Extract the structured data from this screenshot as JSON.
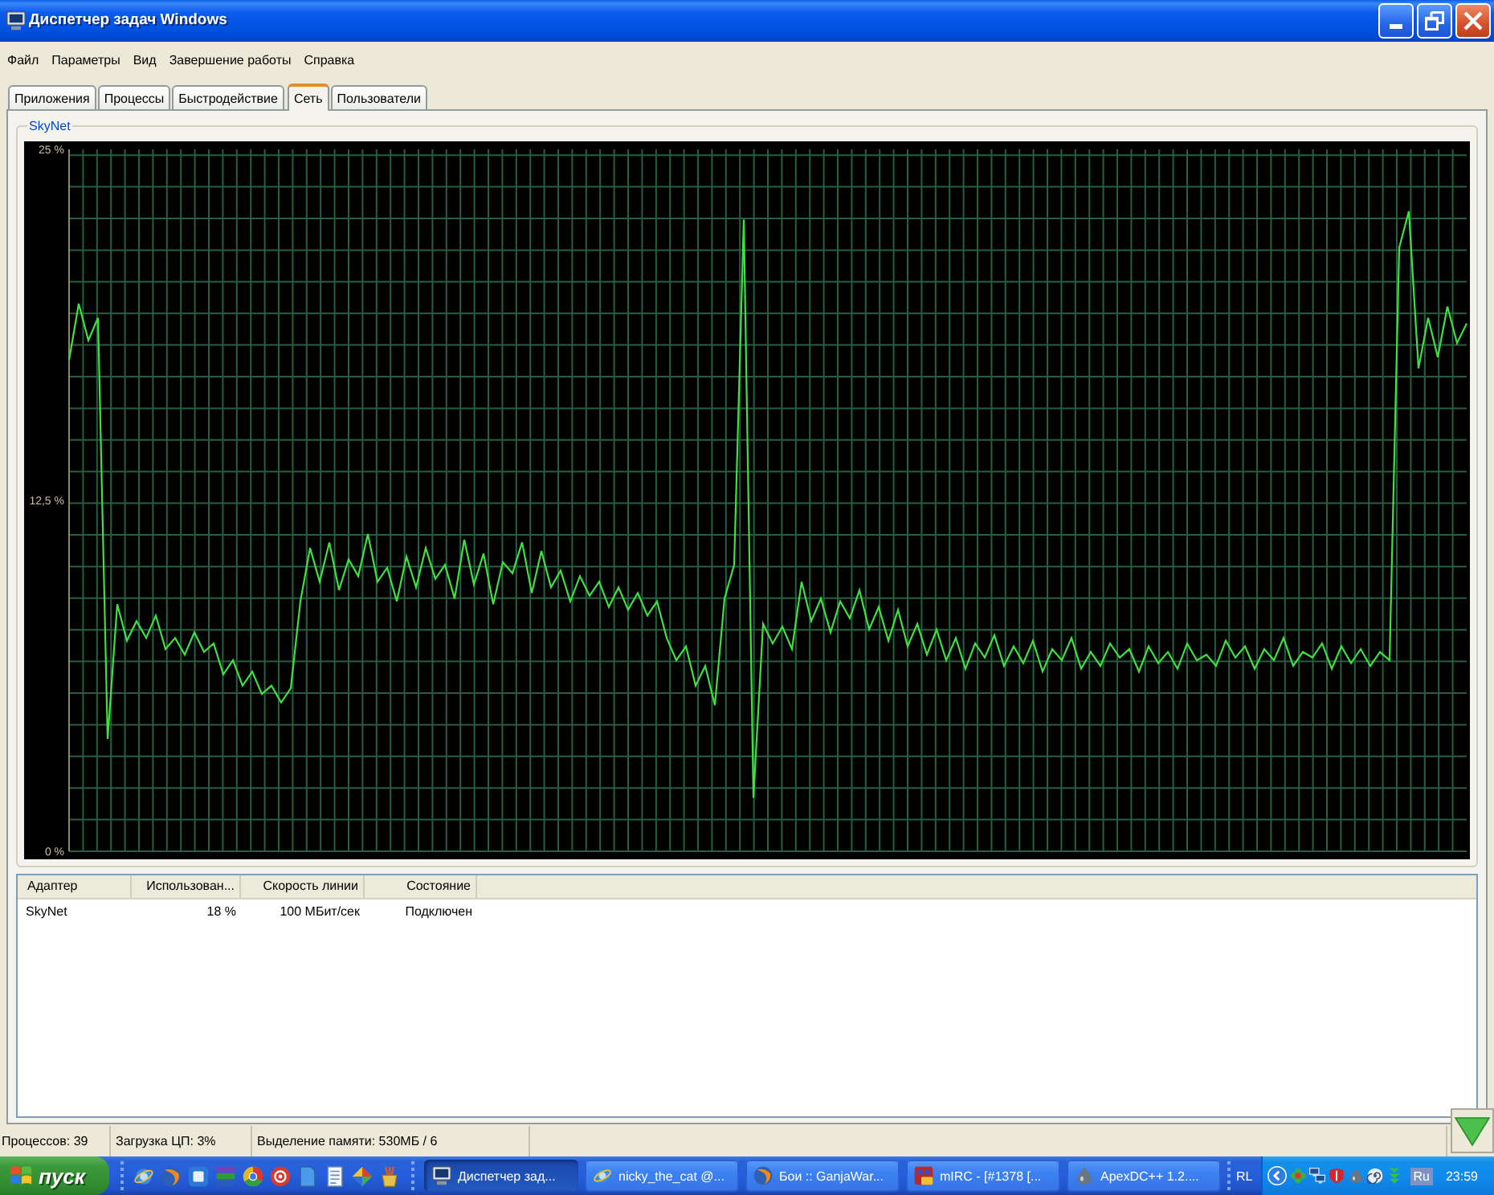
{
  "window": {
    "title": "Диспетчер задач Windows"
  },
  "menu": [
    "Файл",
    "Параметры",
    "Вид",
    "Завершение работы",
    "Справка"
  ],
  "tabs": [
    {
      "label": "Приложения",
      "selected": false
    },
    {
      "label": "Процессы",
      "selected": false
    },
    {
      "label": "Быстродействие",
      "selected": false
    },
    {
      "label": "Сеть",
      "selected": true
    },
    {
      "label": "Пользователи",
      "selected": false
    }
  ],
  "network_graph": {
    "title": "SkyNet",
    "chart_data": {
      "type": "line",
      "ylim": [
        0,
        25
      ],
      "yticks": [
        {
          "value": 0,
          "label": "0 %"
        },
        {
          "value": 12.5,
          "label": "12,5 %"
        },
        {
          "value": 25,
          "label": "25 %"
        }
      ],
      "values": [
        17.5,
        19.5,
        18.2,
        19.0,
        4.0,
        8.8,
        7.5,
        8.2,
        7.6,
        8.4,
        7.2,
        7.6,
        7.0,
        7.8,
        7.1,
        7.4,
        6.3,
        6.8,
        5.9,
        6.4,
        5.6,
        5.9,
        5.3,
        5.8,
        8.9,
        10.8,
        9.6,
        11.0,
        9.3,
        10.4,
        9.8,
        11.3,
        9.6,
        10.1,
        8.9,
        10.5,
        9.4,
        10.8,
        9.7,
        10.2,
        9.0,
        11.1,
        9.5,
        10.6,
        8.8,
        10.3,
        9.9,
        11.0,
        9.2,
        10.7,
        9.4,
        10.0,
        8.9,
        9.8,
        9.1,
        9.6,
        8.7,
        9.4,
        8.6,
        9.2,
        8.4,
        8.9,
        7.6,
        6.8,
        7.3,
        5.9,
        6.6,
        5.2,
        9.0,
        10.2,
        22.5,
        1.9,
        8.1,
        7.4,
        8.0,
        7.2,
        9.6,
        8.2,
        9.0,
        7.8,
        8.9,
        8.3,
        9.3,
        7.9,
        8.7,
        7.5,
        8.6,
        7.3,
        8.1,
        7.0,
        7.9,
        6.8,
        7.6,
        6.5,
        7.4,
        6.9,
        7.7,
        6.6,
        7.3,
        6.7,
        7.5,
        6.4,
        7.2,
        6.8,
        7.6,
        6.5,
        7.1,
        6.6,
        7.4,
        6.9,
        7.2,
        6.4,
        7.3,
        6.7,
        7.1,
        6.5,
        7.4,
        6.8,
        7.0,
        6.6,
        7.5,
        6.9,
        7.3,
        6.5,
        7.2,
        6.8,
        7.6,
        6.6,
        7.1,
        6.9,
        7.4,
        6.5,
        7.3,
        6.7,
        7.2,
        6.6,
        7.1,
        6.8,
        21.5,
        22.8,
        17.2,
        19.0,
        17.6,
        19.4,
        18.1,
        18.8
      ]
    }
  },
  "adapters_table": {
    "columns": [
      "Адаптер",
      "Использован...",
      "Скорость линии",
      "Состояние"
    ],
    "rows": [
      [
        "SkyNet",
        "18 %",
        "100 МБит/сек",
        "Подключен"
      ]
    ]
  },
  "status_bar": [
    "Процессов: 39",
    "Загрузка ЦП: 3%",
    "Выделение памяти: 530МБ / 6"
  ],
  "taskbar": {
    "start": "пуск",
    "tasks": [
      {
        "label": "Диспетчер зад...",
        "selected": true
      },
      {
        "label": "nicky_the_cat @...",
        "selected": false
      },
      {
        "label": "Бои :: GanjaWar...",
        "selected": false
      },
      {
        "label": "mIRC - [#1378 [...",
        "selected": false
      },
      {
        "label": "ApexDC++ 1.2....",
        "selected": false
      }
    ],
    "toolbar_label": "RL",
    "language": "Ru",
    "time": "23:59"
  }
}
